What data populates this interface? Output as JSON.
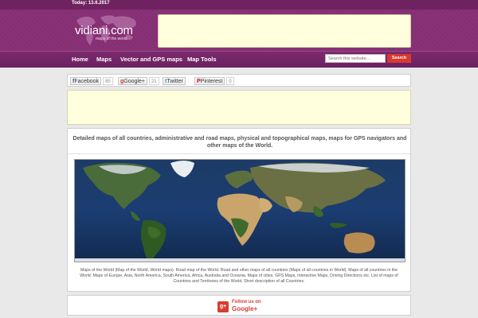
{
  "topbar": {
    "date": "Today: 13.6.2017"
  },
  "logo": {
    "name": "vidiani.com",
    "tagline": "maps of the world"
  },
  "nav": {
    "items": [
      "Home",
      "Maps",
      "Vector and GPS maps",
      "Map Tools"
    ]
  },
  "search": {
    "placeholder": "Search this website...",
    "button": "Search"
  },
  "social": {
    "facebook": {
      "label": "Facebook",
      "count": "85"
    },
    "googleplus": {
      "label": "Google+",
      "count": "21"
    },
    "twitter": {
      "label": "Twitter"
    },
    "pinterest": {
      "label": "Pinterest",
      "count": "0"
    }
  },
  "main": {
    "title": "Detailed maps of all countries, administrative and road maps, physical and topographical maps, maps for GPS navigators and other maps of the World.",
    "caption": "Maps of the World (Map of the World, World maps). Road map of the World. Road and other maps of all countries (Maps of all countries in World). Maps of all countries in the World. Maps of Europe, Asia, North America, South America, Africa, Australia and Oceania. Maps of cities. GPS Maps, Interactive Maps, Driving Directions etc. List of maps of Countries and Territories of the World. Short description of all Countries."
  },
  "follow": {
    "line1": "Follow us on",
    "line2": "Google+"
  },
  "colors": {
    "brand": "#833072",
    "nav": "#6e2360",
    "search_button": "#d93a2e",
    "ad_bg": "#ffffdd"
  }
}
